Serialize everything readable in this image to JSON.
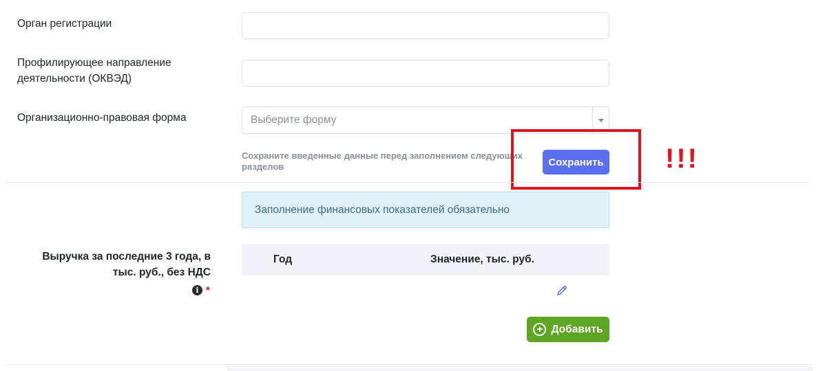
{
  "form": {
    "registration_authority": {
      "label": "Орган регистрации",
      "value": ""
    },
    "okved": {
      "label_line1": "Профилирующее направление",
      "label_line2": "деятельности (ОКВЭД)",
      "value": ""
    },
    "legal_form": {
      "label": "Организационно-правовая форма",
      "placeholder": "Выберите форму"
    }
  },
  "save": {
    "hint_line1": "Сохраните введенные данные перед заполнением следующих",
    "hint_line2": "разделов",
    "button_label": "Сохранить",
    "annotation": "!!!"
  },
  "finance": {
    "alert_text": "Заполнение финансовых показателей обязательно",
    "revenue_label_line1": "Выручка за последние 3 года, в",
    "revenue_label_line2": "тыс. руб., без НДС",
    "required_mark": "*",
    "info_glyph": "i",
    "table": {
      "col_year": "Год",
      "col_value": "Значение, тыс. руб."
    },
    "add_button_label": "Добавить",
    "add_glyph": "+"
  },
  "colors": {
    "primary": "#5b6ef0",
    "success": "#5da523",
    "annotation_red": "#e0121e",
    "alert_bg": "#dff0f7"
  },
  "icons": [
    "info-circle-icon",
    "pencil-icon",
    "plus-circle-icon",
    "caret-down-icon"
  ]
}
